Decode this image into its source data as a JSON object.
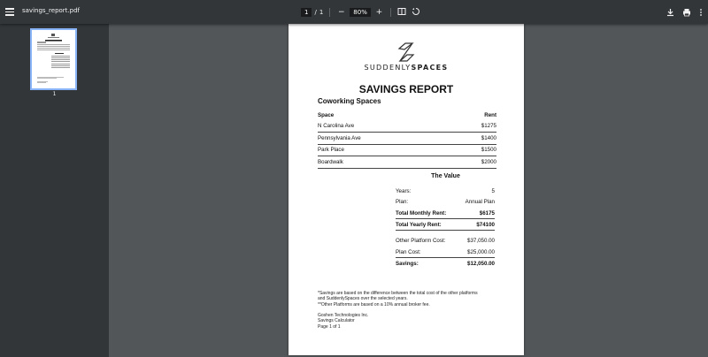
{
  "toolbar": {
    "file_name": "savings_report.pdf",
    "page_current": "1",
    "page_sep": "/",
    "page_total": "1",
    "zoom_out": "−",
    "zoom": "80%",
    "zoom_in": "+"
  },
  "sidebar": {
    "thumb_number": "1"
  },
  "document": {
    "brand_light": "SUDDENLY",
    "brand_bold": "SPACES",
    "title": "SAVINGS REPORT",
    "section": "Coworking Spaces",
    "columns": [
      "Space",
      "Rent"
    ],
    "rows": [
      {
        "space": "N Carolina Ave",
        "rent": "$1275"
      },
      {
        "space": "Pennsylvania Ave",
        "rent": "$1400"
      },
      {
        "space": "Park Place",
        "rent": "$1500"
      },
      {
        "space": "Boardwalk",
        "rent": "$2000"
      }
    ],
    "value_title": "The Value",
    "value": {
      "years_label": "Years:",
      "years": "5",
      "plan_label": "Plan:",
      "plan": "Annual Plan",
      "monthly_label": "Total Monthly Rent:",
      "monthly": "$6175",
      "yearly_label": "Total Yearly Rent:",
      "yearly": "$74100",
      "other_label": "Other Platform Cost:",
      "other": "$37,050.00",
      "plancost_label": "Plan Cost:",
      "plancost": "$25,000.00",
      "savings_label": "Savings:",
      "savings": "$12,050.00"
    },
    "footnote_1": "*Savings are based on the difference between the total cost of the other platforms",
    "footnote_2": "and SuddenlySpaces over the selected years.",
    "footnote_3": "**Other Platforms are based on a 10% annual broker fee.",
    "company": "Goshen Technologies Inc.",
    "product": "Savings Calculator",
    "page_label": "Page 1 of 1"
  }
}
